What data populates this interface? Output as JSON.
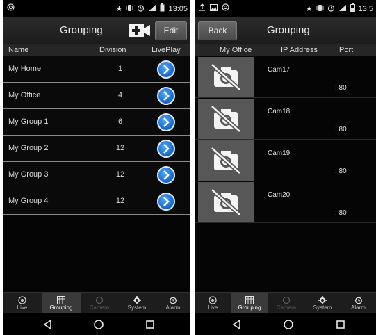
{
  "colors": {
    "accent_blue": "#1e7be0",
    "tab_active": "#3a3a3a",
    "tab_disabled": "#5a5a5a"
  },
  "left": {
    "status": {
      "time": "13:05",
      "icons": [
        "wifi-icon",
        "star-icon",
        "vibrate-icon",
        "alarm-clock-icon",
        "signal-icon",
        "battery-icon"
      ]
    },
    "header": {
      "title": "Grouping",
      "edit_label": "Edit",
      "add_icon": "add-camera-icon"
    },
    "columns": {
      "name": "Name",
      "division": "Division",
      "liveplay": "LivePlay"
    },
    "groups": [
      {
        "name": "My Home",
        "division": "1"
      },
      {
        "name": "My Office",
        "division": "4"
      },
      {
        "name": "My Group 1",
        "division": "6"
      },
      {
        "name": "My Group 2",
        "division": "12"
      },
      {
        "name": "My Group 3",
        "division": "12"
      },
      {
        "name": "My Group 4",
        "division": "12"
      }
    ],
    "tabs": [
      {
        "label": "Live",
        "icon": "live-icon",
        "state": "normal"
      },
      {
        "label": "Grouping",
        "icon": "grouping-icon",
        "state": "active"
      },
      {
        "label": "Camera",
        "icon": "camera-icon",
        "state": "disabled"
      },
      {
        "label": "System",
        "icon": "gear-icon",
        "state": "normal"
      },
      {
        "label": "Alarm",
        "icon": "alarm-icon",
        "state": "normal"
      }
    ]
  },
  "right": {
    "status": {
      "time": "13:5",
      "icons": [
        "upload-icon",
        "image-icon",
        "wifi-icon",
        "star-icon",
        "vibrate-icon",
        "alarm-clock-icon",
        "signal-icon",
        "battery-icon"
      ]
    },
    "header": {
      "title": "Grouping",
      "back_label": "Back"
    },
    "columns": {
      "group": "My Office",
      "ip": "IP Address",
      "port": "Port"
    },
    "cameras": [
      {
        "name": "Cam17",
        "port": ": 80"
      },
      {
        "name": "Cam18",
        "port": ": 80"
      },
      {
        "name": "Cam19",
        "port": ": 80"
      },
      {
        "name": "Cam20",
        "port": ": 80"
      }
    ],
    "tabs": [
      {
        "label": "Live",
        "icon": "live-icon",
        "state": "normal"
      },
      {
        "label": "Grouping",
        "icon": "grouping-icon",
        "state": "active"
      },
      {
        "label": "Camera",
        "icon": "camera-icon",
        "state": "disabled"
      },
      {
        "label": "System",
        "icon": "gear-icon",
        "state": "normal"
      },
      {
        "label": "Alarm",
        "icon": "alarm-icon",
        "state": "normal"
      }
    ]
  }
}
